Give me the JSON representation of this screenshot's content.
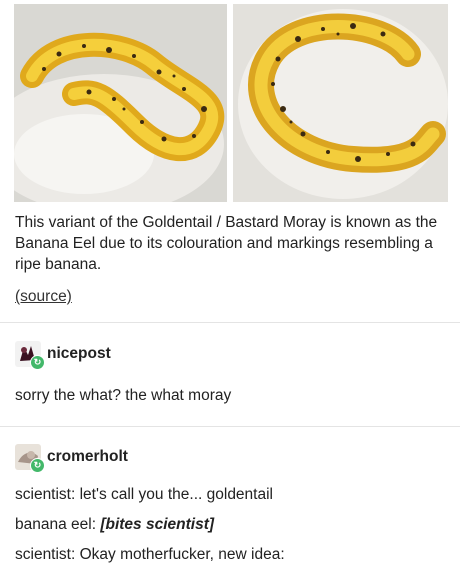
{
  "post": {
    "caption": "This variant of the Goldentail / Bastard Moray is known as the Banana Eel due to its colouration and markings resembling a ripe banana.",
    "source_link": "(source)"
  },
  "replies": [
    {
      "username": "nicepost",
      "lines": [
        "sorry the what? the what moray"
      ]
    },
    {
      "username": "cromerholt",
      "lines": [
        {
          "prefix": "scientist: ",
          "text": "let's call you the... goldentail"
        },
        {
          "prefix": "banana eel: ",
          "emphasis": "[bites scientist]"
        },
        {
          "prefix": "scientist: ",
          "text": "Okay motherfucker, new idea:"
        }
      ]
    }
  ],
  "icons": {
    "reblog_badge": "reblog-icon"
  }
}
